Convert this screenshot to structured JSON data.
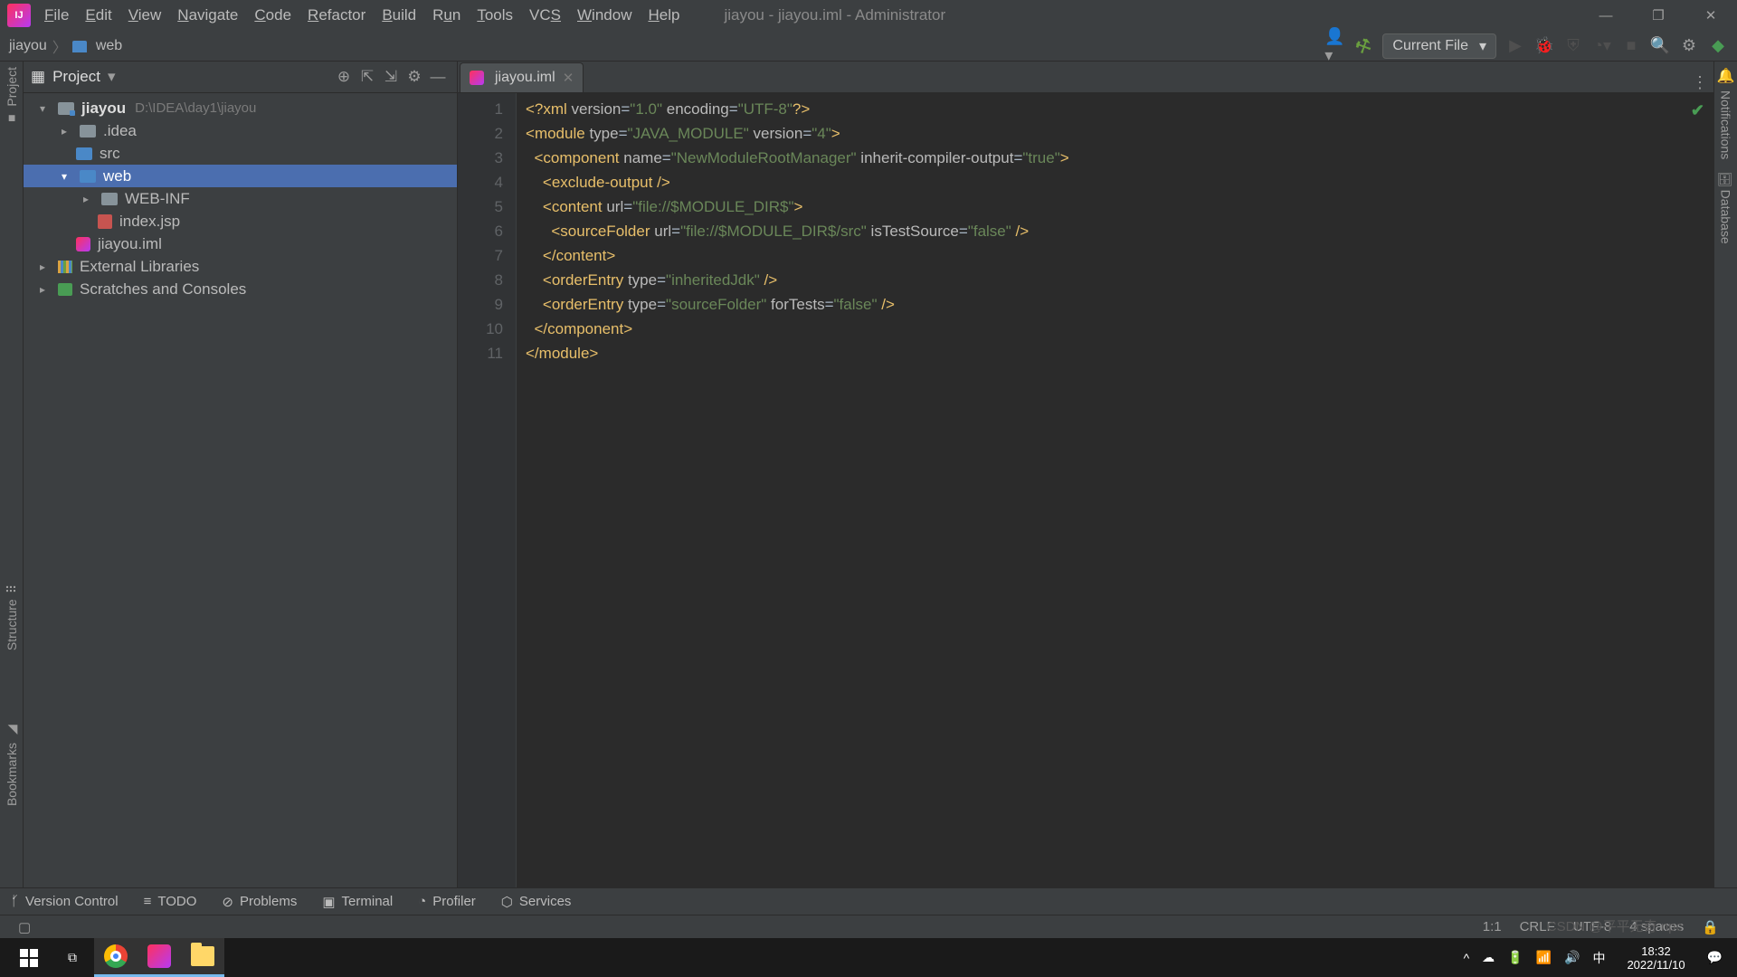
{
  "window_title": "jiayou - jiayou.iml - Administrator",
  "menu": {
    "file": "File",
    "edit": "Edit",
    "view": "View",
    "navigate": "Navigate",
    "code": "Code",
    "refactor": "Refactor",
    "build": "Build",
    "run": "Run",
    "tools": "Tools",
    "vcs": "VCS",
    "window": "Window",
    "help": "Help"
  },
  "breadcrumbs": {
    "root": "jiayou",
    "child": "web"
  },
  "run_config": "Current File",
  "project_label": "Project",
  "tree": {
    "root": "jiayou",
    "root_path": "D:\\IDEA\\day1\\jiayou",
    "idea": ".idea",
    "src": "src",
    "web": "web",
    "webinf": "WEB-INF",
    "indexjsp": "index.jsp",
    "iml": "jiayou.iml",
    "ext": "External Libraries",
    "scratch": "Scratches and Consoles"
  },
  "tab": {
    "name": "jiayou.iml"
  },
  "code_lines": [
    "1",
    "2",
    "3",
    "4",
    "5",
    "6",
    "7",
    "8",
    "9",
    "10",
    "11"
  ],
  "xml": {
    "ver_attr": "version",
    "ver_val": "\"1.0\"",
    "enc_attr": "encoding",
    "enc_val": "\"UTF-8\"",
    "module": "module",
    "type_attr": "type",
    "type_val": "\"JAVA_MODULE\"",
    "mver_attr": "version",
    "mver_val": "\"4\"",
    "component": "component",
    "name_attr": "name",
    "name_val": "\"NewModuleRootManager\"",
    "ico_attr": "inherit-compiler-output",
    "ico_val": "\"true\"",
    "exclude": "exclude-output",
    "content": "content",
    "url_attr": "url",
    "url_val": "\"file://$MODULE_DIR$\"",
    "srcfolder": "sourceFolder",
    "src_url_val": "\"file://$MODULE_DIR$/src\"",
    "its_attr": "isTestSource",
    "its_val": "\"false\"",
    "order": "orderEntry",
    "otype_attr": "type",
    "ij_val": "\"inheritedJdk\"",
    "sf_val": "\"sourceFolder\"",
    "ft_attr": "forTests",
    "ft_val": "\"false\""
  },
  "bottom": {
    "vc": "Version Control",
    "todo": "TODO",
    "problems": "Problems",
    "terminal": "Terminal",
    "profiler": "Profiler",
    "services": "Services"
  },
  "status": {
    "pos": "1:1",
    "linesep": "CRLF",
    "enc": "UTF-8",
    "indent": "4 spaces"
  },
  "sidetool": {
    "project": "Project",
    "structure": "Structure",
    "bookmarks": "Bookmarks",
    "notifications": "Notifications",
    "database": "Database"
  },
  "taskbar": {
    "time": "18:32",
    "date": "2022/11/10"
  },
  "watermark": "CSDN @平平无奇 npc"
}
